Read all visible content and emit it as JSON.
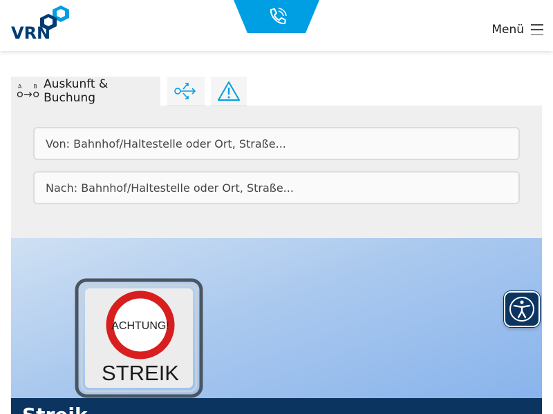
{
  "header": {
    "logo_text": "VRN",
    "menu_label": "Menü",
    "brand_color": "#009ee3",
    "navy_color": "#003b73"
  },
  "tabs": [
    {
      "label": "Auskunft & Buchung",
      "icon": "route-a-to-b-icon",
      "active": true
    },
    {
      "label": "",
      "icon": "share-connections-icon",
      "active": false
    },
    {
      "label": "",
      "icon": "warning-triangle-icon",
      "active": false
    }
  ],
  "search": {
    "from_placeholder": "Von: Bahnhof/Haltestelle oder Ort, Straße...",
    "to_placeholder": "Nach: Bahnhof/Haltestelle oder Ort, Straße..."
  },
  "hero": {
    "sign_top_text": "ACHTUNG!",
    "sign_bottom_text": "STREIK",
    "caption": "Streik"
  },
  "accessibility": {
    "icon": "accessibility-person-icon"
  }
}
